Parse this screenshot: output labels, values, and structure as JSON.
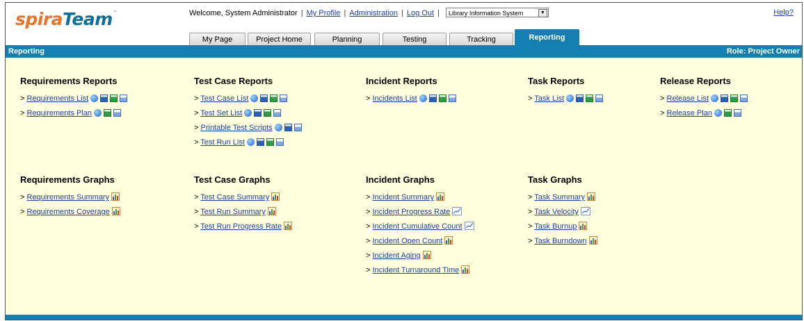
{
  "header": {
    "logo_part1": "spira",
    "logo_part2": "Team",
    "logo_tm": "™",
    "welcome": "Welcome, System Administrator",
    "my_profile": "My Profile",
    "administration": "Administration",
    "log_out": "Log Out",
    "separator": "|",
    "project": "Library Information System",
    "help": "Help?"
  },
  "tabs": [
    {
      "label": "My Page"
    },
    {
      "label": "Project Home"
    },
    {
      "label": "Planning"
    },
    {
      "label": "Testing"
    },
    {
      "label": "Tracking"
    },
    {
      "label": "Reporting",
      "active": true
    }
  ],
  "bar": {
    "title": "Reporting",
    "role": "Role: Project Owner"
  },
  "arrow": ">",
  "reports": [
    {
      "title": "Requirements Reports",
      "items": [
        {
          "label": "Requirements List",
          "icons": [
            "html",
            "word",
            "excel",
            "xml"
          ]
        },
        {
          "label": "Requirements Plan",
          "icons": [
            "html",
            "excel",
            "xml"
          ]
        }
      ]
    },
    {
      "title": "Test Case Reports",
      "items": [
        {
          "label": "Test Case List",
          "icons": [
            "html",
            "word",
            "excel",
            "xml"
          ]
        },
        {
          "label": "Test Set List",
          "icons": [
            "html",
            "word",
            "excel",
            "xml"
          ]
        },
        {
          "label": "Printable Test Scripts",
          "icons": [
            "html",
            "word",
            "xml"
          ]
        },
        {
          "label": "Test Run List",
          "icons": [
            "html",
            "word",
            "excel",
            "xml"
          ]
        }
      ]
    },
    {
      "title": "Incident Reports",
      "items": [
        {
          "label": "Incidents List",
          "icons": [
            "html",
            "word",
            "excel",
            "xml"
          ]
        }
      ]
    },
    {
      "title": "Task Reports",
      "items": [
        {
          "label": "Task List",
          "icons": [
            "html",
            "word",
            "excel",
            "xml"
          ]
        }
      ]
    },
    {
      "title": "Release Reports",
      "items": [
        {
          "label": "Release List",
          "icons": [
            "html",
            "word",
            "excel",
            "xml"
          ]
        },
        {
          "label": "Release Plan",
          "icons": [
            "html",
            "excel",
            "xml"
          ]
        }
      ]
    }
  ],
  "graphs": [
    {
      "title": "Requirements Graphs",
      "items": [
        {
          "label": "Requirements Summary",
          "icon": "bar"
        },
        {
          "label": "Requirements Coverage",
          "icon": "bar"
        }
      ]
    },
    {
      "title": "Test Case Graphs",
      "items": [
        {
          "label": "Test Case Summary",
          "icon": "bar"
        },
        {
          "label": "Test Run Summary",
          "icon": "bar"
        },
        {
          "label": "Test Run Progress Rate",
          "icon": "bar"
        }
      ]
    },
    {
      "title": "Incident Graphs",
      "items": [
        {
          "label": "Incident Summary",
          "icon": "bar"
        },
        {
          "label": "Incident Progress Rate",
          "icon": "line"
        },
        {
          "label": "Incident Cumulative Count",
          "icon": "line"
        },
        {
          "label": "Incident Open Count",
          "icon": "bar"
        },
        {
          "label": "Incident Aging",
          "icon": "bar"
        },
        {
          "label": "Incident Turnaround Time",
          "icon": "bar"
        }
      ]
    },
    {
      "title": "Task Graphs",
      "items": [
        {
          "label": "Task Summary",
          "icon": "bar"
        },
        {
          "label": "Task Velocity",
          "icon": "line"
        },
        {
          "label": "Task Burnup",
          "icon": "bar"
        },
        {
          "label": "Task Burndown",
          "icon": "bar"
        }
      ]
    }
  ]
}
